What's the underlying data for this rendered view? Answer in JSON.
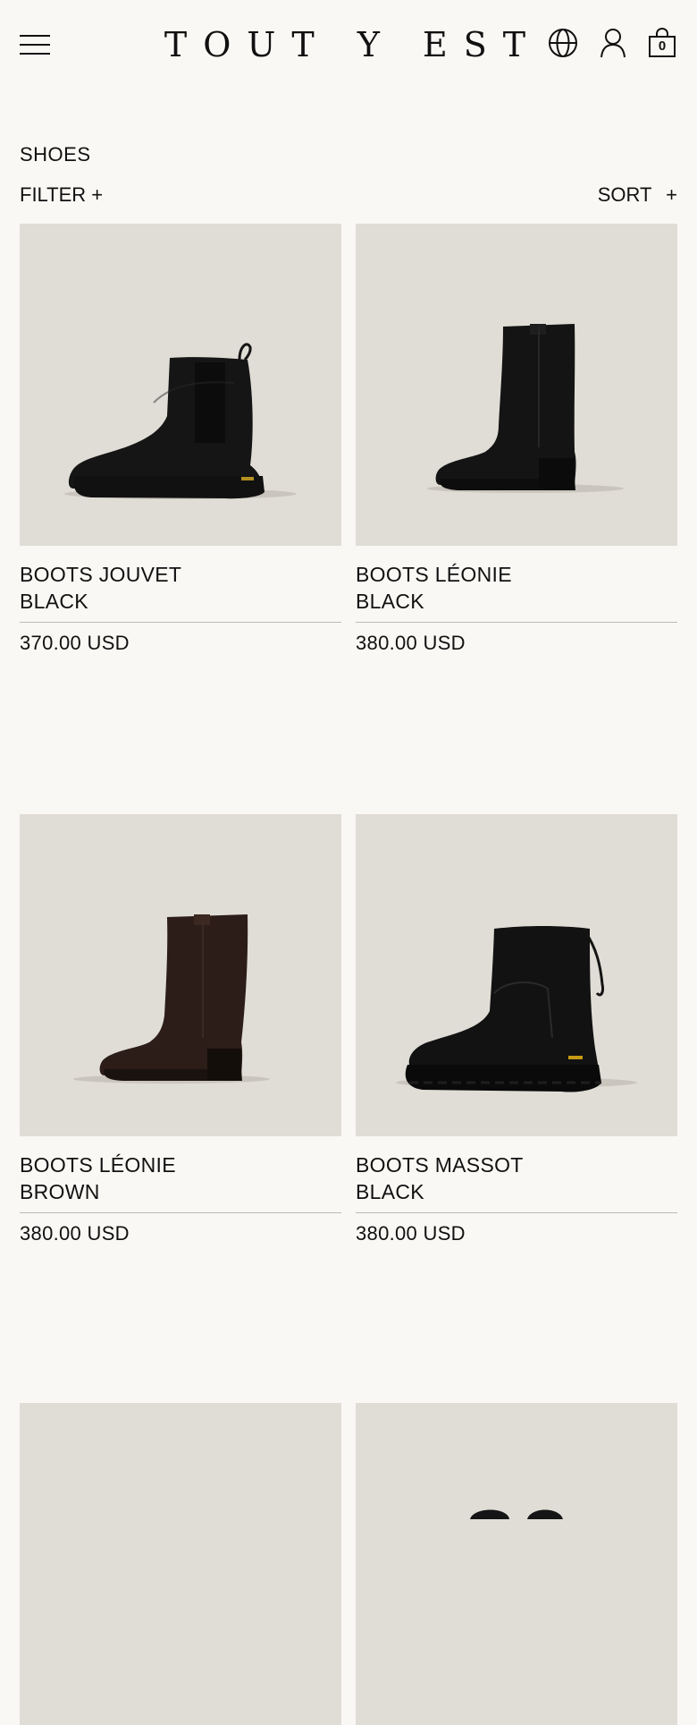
{
  "header": {
    "logo": "TOUT Y EST",
    "cart_count": "0",
    "icons": [
      "menu-icon",
      "globe-icon",
      "account-icon",
      "shopping-bag-icon"
    ]
  },
  "page": {
    "title": "SHOES",
    "filter_label": "FILTER +",
    "sort_label": "SORT +"
  },
  "products": [
    {
      "name": "BOOTS JOUVET",
      "color": "BLACK",
      "price": "370.00 USD",
      "boot_color": "#151515"
    },
    {
      "name": "BOOTS LÉONIE",
      "color": "BLACK",
      "price": "380.00 USD",
      "boot_color": "#141414"
    },
    {
      "name": "BOOTS LÉONIE",
      "color": "BROWN",
      "price": "380.00 USD",
      "boot_color": "#2c1d18"
    },
    {
      "name": "BOOTS MASSOT",
      "color": "BLACK",
      "price": "380.00 USD",
      "boot_color": "#121212"
    },
    {
      "name": "",
      "color": "",
      "price": "",
      "boot_color": "#151515"
    },
    {
      "name": "",
      "color": "",
      "price": "",
      "boot_color": "#151515"
    }
  ],
  "colors": {
    "background": "#f9f8f5",
    "image_bg": "#e0ddd6",
    "divider": "#bdbab4",
    "text": "#111111"
  }
}
